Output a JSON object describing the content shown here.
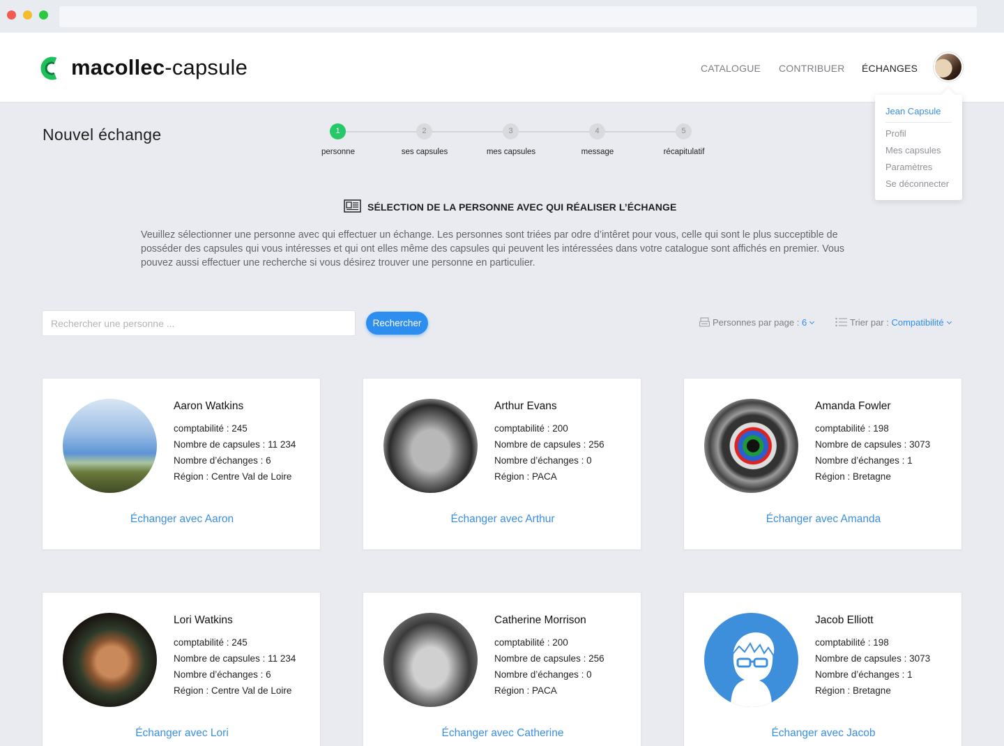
{
  "header": {
    "logo_bold": "macollec",
    "logo_rest": "-capsule",
    "nav": [
      "CATALOGUE",
      "CONTRIBUER",
      "ÉCHANGES"
    ]
  },
  "user_menu": {
    "name": "Jean Capsule",
    "items": [
      "Profil",
      "Mes capsules",
      "Paramètres",
      "Se déconnecter"
    ]
  },
  "page": {
    "title": "Nouvel échange",
    "steps": [
      {
        "num": "1",
        "label": "personne",
        "state": "done"
      },
      {
        "num": "2",
        "label": "ses capsules",
        "state": "todo"
      },
      {
        "num": "3",
        "label": "mes capsules",
        "state": "todo"
      },
      {
        "num": "4",
        "label": "message",
        "state": "todo"
      },
      {
        "num": "5",
        "label": "récapitulatif",
        "state": "todo"
      }
    ],
    "section_title": "SÉLECTION DE LA PERSONNE AVEC QUI RÉALISER L’ÉCHANGE",
    "intro": "Veuillez sélectionner une personne avec qui effectuer un échange. Les personnes sont triées par odre d’intêret pour vous, celle qui sont le plus succeptible de posséder des capsules qui vous intéresses et qui ont elles même des capsules qui peuvent les intéressées dans votre catalogue sont affichés en premier. Vous pouvez aussi effectuer une recherche si vous désirez trouver une personne en particulier."
  },
  "search": {
    "placeholder": "Rechercher une personne ...",
    "button": "Rechercher"
  },
  "controls": {
    "per_page_label": "Personnes par page :",
    "per_page_value": "6",
    "sort_label": "Trier par :",
    "sort_value": "Compatibilité"
  },
  "colors": {
    "accent": "#2e8ef0",
    "link": "#3a8ee6",
    "step_done": "#27c86a",
    "logo_green": "#1fbf5a"
  },
  "people": [
    {
      "name": "Aaron Watkins",
      "compat": "comptabilité : 245",
      "capsules": "Nombre de capsules : 11 234",
      "echanges": "Nombre d’échanges :  6",
      "region": "Région : Centre Val de Loire",
      "action": "Échanger avec Aaron",
      "photo": "sky-landscape"
    },
    {
      "name": "Arthur Evans",
      "compat": "comptabilité : 200",
      "capsules": "Nombre de capsules : 256",
      "echanges": "Nombre d’échanges :  0",
      "region": "Région : PACA",
      "action": "Échanger avec Arthur",
      "photo": "man-bw"
    },
    {
      "name": "Amanda Fowler",
      "compat": "comptabilité : 198",
      "capsules": "Nombre de capsules : 3073",
      "echanges": "Nombre d’échanges :  1",
      "region": "Région : Bretagne",
      "action": "Échanger avec Amanda",
      "photo": "eye-color"
    },
    {
      "name": "Lori Watkins",
      "compat": "comptabilité : 245",
      "capsules": "Nombre de capsules : 11 234",
      "echanges": "Nombre d’échanges :  6",
      "region": "Région : Centre Val de Loire",
      "action": "Échanger avec Lori",
      "photo": "woman-hijab"
    },
    {
      "name": "Catherine Morrison",
      "compat": "comptabilité : 200",
      "capsules": "Nombre de capsules : 256",
      "echanges": "Nombre d’échanges :  0",
      "region": "Région : PACA",
      "action": "Échanger avec Catherine",
      "photo": "woman-bw"
    },
    {
      "name": "Jacob Elliott",
      "compat": "comptabilité : 198",
      "capsules": "Nombre de capsules : 3073",
      "echanges": "Nombre d’échanges :  1",
      "region": "Région : Bretagne",
      "action": "Échanger avec Jacob",
      "photo": "default-avatar"
    }
  ]
}
